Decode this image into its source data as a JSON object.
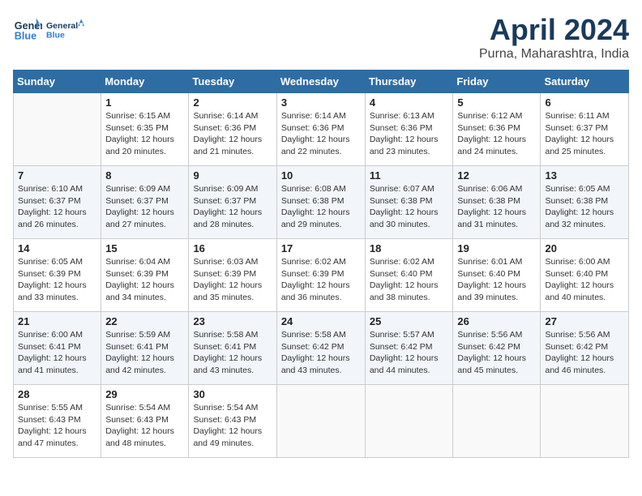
{
  "header": {
    "logo_line1": "General",
    "logo_line2": "Blue",
    "month": "April 2024",
    "location": "Purna, Maharashtra, India"
  },
  "days_of_week": [
    "Sunday",
    "Monday",
    "Tuesday",
    "Wednesday",
    "Thursday",
    "Friday",
    "Saturday"
  ],
  "weeks": [
    [
      {
        "day": "",
        "info": ""
      },
      {
        "day": "1",
        "info": "Sunrise: 6:15 AM\nSunset: 6:35 PM\nDaylight: 12 hours\nand 20 minutes."
      },
      {
        "day": "2",
        "info": "Sunrise: 6:14 AM\nSunset: 6:36 PM\nDaylight: 12 hours\nand 21 minutes."
      },
      {
        "day": "3",
        "info": "Sunrise: 6:14 AM\nSunset: 6:36 PM\nDaylight: 12 hours\nand 22 minutes."
      },
      {
        "day": "4",
        "info": "Sunrise: 6:13 AM\nSunset: 6:36 PM\nDaylight: 12 hours\nand 23 minutes."
      },
      {
        "day": "5",
        "info": "Sunrise: 6:12 AM\nSunset: 6:36 PM\nDaylight: 12 hours\nand 24 minutes."
      },
      {
        "day": "6",
        "info": "Sunrise: 6:11 AM\nSunset: 6:37 PM\nDaylight: 12 hours\nand 25 minutes."
      }
    ],
    [
      {
        "day": "7",
        "info": "Sunrise: 6:10 AM\nSunset: 6:37 PM\nDaylight: 12 hours\nand 26 minutes."
      },
      {
        "day": "8",
        "info": "Sunrise: 6:09 AM\nSunset: 6:37 PM\nDaylight: 12 hours\nand 27 minutes."
      },
      {
        "day": "9",
        "info": "Sunrise: 6:09 AM\nSunset: 6:37 PM\nDaylight: 12 hours\nand 28 minutes."
      },
      {
        "day": "10",
        "info": "Sunrise: 6:08 AM\nSunset: 6:38 PM\nDaylight: 12 hours\nand 29 minutes."
      },
      {
        "day": "11",
        "info": "Sunrise: 6:07 AM\nSunset: 6:38 PM\nDaylight: 12 hours\nand 30 minutes."
      },
      {
        "day": "12",
        "info": "Sunrise: 6:06 AM\nSunset: 6:38 PM\nDaylight: 12 hours\nand 31 minutes."
      },
      {
        "day": "13",
        "info": "Sunrise: 6:05 AM\nSunset: 6:38 PM\nDaylight: 12 hours\nand 32 minutes."
      }
    ],
    [
      {
        "day": "14",
        "info": "Sunrise: 6:05 AM\nSunset: 6:39 PM\nDaylight: 12 hours\nand 33 minutes."
      },
      {
        "day": "15",
        "info": "Sunrise: 6:04 AM\nSunset: 6:39 PM\nDaylight: 12 hours\nand 34 minutes."
      },
      {
        "day": "16",
        "info": "Sunrise: 6:03 AM\nSunset: 6:39 PM\nDaylight: 12 hours\nand 35 minutes."
      },
      {
        "day": "17",
        "info": "Sunrise: 6:02 AM\nSunset: 6:39 PM\nDaylight: 12 hours\nand 36 minutes."
      },
      {
        "day": "18",
        "info": "Sunrise: 6:02 AM\nSunset: 6:40 PM\nDaylight: 12 hours\nand 38 minutes."
      },
      {
        "day": "19",
        "info": "Sunrise: 6:01 AM\nSunset: 6:40 PM\nDaylight: 12 hours\nand 39 minutes."
      },
      {
        "day": "20",
        "info": "Sunrise: 6:00 AM\nSunset: 6:40 PM\nDaylight: 12 hours\nand 40 minutes."
      }
    ],
    [
      {
        "day": "21",
        "info": "Sunrise: 6:00 AM\nSunset: 6:41 PM\nDaylight: 12 hours\nand 41 minutes."
      },
      {
        "day": "22",
        "info": "Sunrise: 5:59 AM\nSunset: 6:41 PM\nDaylight: 12 hours\nand 42 minutes."
      },
      {
        "day": "23",
        "info": "Sunrise: 5:58 AM\nSunset: 6:41 PM\nDaylight: 12 hours\nand 43 minutes."
      },
      {
        "day": "24",
        "info": "Sunrise: 5:58 AM\nSunset: 6:42 PM\nDaylight: 12 hours\nand 43 minutes."
      },
      {
        "day": "25",
        "info": "Sunrise: 5:57 AM\nSunset: 6:42 PM\nDaylight: 12 hours\nand 44 minutes."
      },
      {
        "day": "26",
        "info": "Sunrise: 5:56 AM\nSunset: 6:42 PM\nDaylight: 12 hours\nand 45 minutes."
      },
      {
        "day": "27",
        "info": "Sunrise: 5:56 AM\nSunset: 6:42 PM\nDaylight: 12 hours\nand 46 minutes."
      }
    ],
    [
      {
        "day": "28",
        "info": "Sunrise: 5:55 AM\nSunset: 6:43 PM\nDaylight: 12 hours\nand 47 minutes."
      },
      {
        "day": "29",
        "info": "Sunrise: 5:54 AM\nSunset: 6:43 PM\nDaylight: 12 hours\nand 48 minutes."
      },
      {
        "day": "30",
        "info": "Sunrise: 5:54 AM\nSunset: 6:43 PM\nDaylight: 12 hours\nand 49 minutes."
      },
      {
        "day": "",
        "info": ""
      },
      {
        "day": "",
        "info": ""
      },
      {
        "day": "",
        "info": ""
      },
      {
        "day": "",
        "info": ""
      }
    ]
  ]
}
